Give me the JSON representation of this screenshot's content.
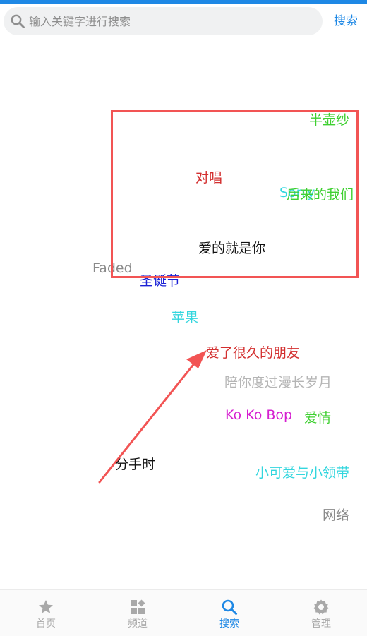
{
  "header": {
    "search_placeholder": "输入关键字进行搜索",
    "search_button_label": "搜索",
    "accent_color": "#1e88e5"
  },
  "tag_cloud": {
    "tags": [
      {
        "text": "半壶纱",
        "color": "#3fd031"
      },
      {
        "text": "对唱",
        "color": "#d32f2f"
      },
      {
        "text": "后来的我们",
        "color": "#3fd031"
      },
      {
        "text": "Sorry",
        "color": "#33d6de"
      },
      {
        "text": "爱的就是你",
        "color": "#111111"
      },
      {
        "text": "Faded",
        "color": "#8a8a8a"
      },
      {
        "text": "圣诞节",
        "color": "#1a21d6"
      },
      {
        "text": "苹果",
        "color": "#33d6de"
      },
      {
        "text": "爱了很久的朋友",
        "color": "#d32f2f"
      },
      {
        "text": "陪你度过漫长岁月",
        "color": "#b5b5b5"
      },
      {
        "text": "Ko Ko Bop",
        "color": "#d51fd0"
      },
      {
        "text": "爱情",
        "color": "#3fd031"
      },
      {
        "text": "分手时",
        "color": "#111111"
      },
      {
        "text": "小可爱与小领带",
        "color": "#33d6de"
      },
      {
        "text": "网络",
        "color": "#8a8a8a"
      }
    ]
  },
  "annotation": {
    "color": "#f25454"
  },
  "tabbar": {
    "tabs": [
      {
        "label": "首页",
        "icon": "star-icon",
        "active": false
      },
      {
        "label": "频道",
        "icon": "grid-icon",
        "active": false
      },
      {
        "label": "搜索",
        "icon": "search-icon",
        "active": true
      },
      {
        "label": "管理",
        "icon": "gear-icon",
        "active": false
      }
    ],
    "active_color": "#1e88e5",
    "inactive_color": "#a9a9a9"
  }
}
